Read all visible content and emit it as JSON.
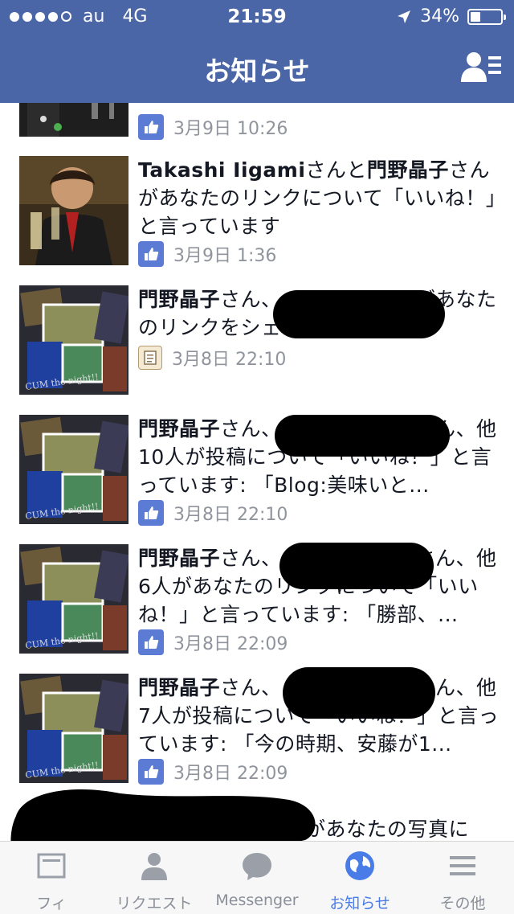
{
  "status_bar": {
    "carrier": "au",
    "network": "4G",
    "time": "21:59",
    "battery": "34%",
    "battery_level": 0.34
  },
  "nav": {
    "title": "お知らせ",
    "right_icon": "friend-requests-icon"
  },
  "notifications": [
    {
      "text": "」",
      "time": "3月9日 10:26",
      "type": "like"
    },
    {
      "name1": "Takashi Iigami",
      "mid": "さんと",
      "name2": "門野晶子",
      "rest": "さんがあなたのリンクについて「いいね！」と言っています",
      "time": "3月9日 1:36",
      "type": "like"
    },
    {
      "name1": "門野晶子",
      "rest": "さん、　　　　　　　があなたのリンクをシェアしました",
      "time": "3月8日 22:10",
      "type": "share"
    },
    {
      "name1": "門野晶子",
      "rest": "さん、　　　　　　　さん、他10人が投稿について「いいね！」と言っています: 「Blog:美味いと...",
      "time": "3月8日 22:10",
      "type": "like"
    },
    {
      "name1": "門野晶子",
      "rest": "さん、　　　　　　　さん、他6人があなたのリンクについて「いいね！」と言っています: 「勝部、...",
      "time": "3月8日 22:09",
      "type": "like"
    },
    {
      "name1": "門野晶子",
      "rest": "さん、　　　　　　　さん、他7人が投稿について「いいね！」と言っています: 「今の時期、安藤が1...",
      "time": "3月8日 22:09",
      "type": "like"
    },
    {
      "rest": "があなたの写真に",
      "type": "partial"
    }
  ],
  "tabs": [
    {
      "label": "フィ",
      "icon": "news-feed-icon"
    },
    {
      "label": "リクエスト",
      "icon": "friend-requests-icon"
    },
    {
      "label": "Messenger",
      "icon": "messenger-icon"
    },
    {
      "label": "お知らせ",
      "icon": "globe-icon",
      "active": true
    },
    {
      "label": "その他",
      "icon": "menu-icon"
    }
  ],
  "colors": {
    "header": "#4b66a6",
    "like": "#5b7bd5",
    "active_tab": "#4a7ce8",
    "meta_text": "#90949c"
  }
}
